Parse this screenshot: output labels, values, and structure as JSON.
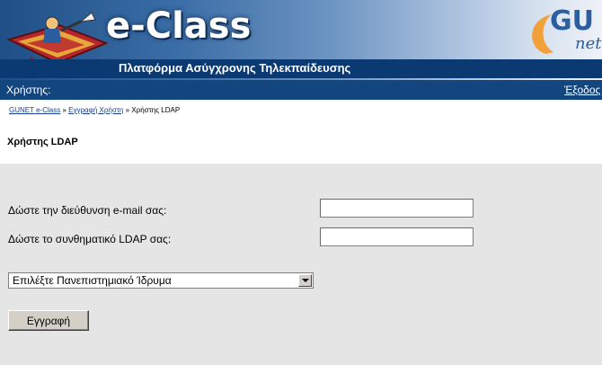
{
  "header": {
    "brand": "e-Class",
    "tagline": "Πλατφόρμα Ασύγχρονης Τηλεκπαίδευσης",
    "partner_logo_text": "GU",
    "partner_logo_sub": "net"
  },
  "userbar": {
    "user_label": "Χρήστης:",
    "logout_label": "Έξοδος"
  },
  "breadcrumb": {
    "items": [
      "GUNET e-Class",
      "Εγγραφή Χρήστη",
      "Χρήστης LDAP"
    ],
    "separator": "»"
  },
  "page": {
    "title": "Χρήστης LDAP"
  },
  "form": {
    "email_label": "Δώστε την διεύθυνση e-mail σας:",
    "email_value": "",
    "password_label": "Δώστε το συνθηματικό LDAP σας:",
    "password_value": "",
    "institution_selected": "Επιλέξτε Πανεπιστημιακό Ίδρυμα",
    "submit_label": "Εγγραφή"
  },
  "colors": {
    "banner_dark": "#0b3a73",
    "userbar": "#13467f",
    "form_bg": "#e5e5e5"
  }
}
